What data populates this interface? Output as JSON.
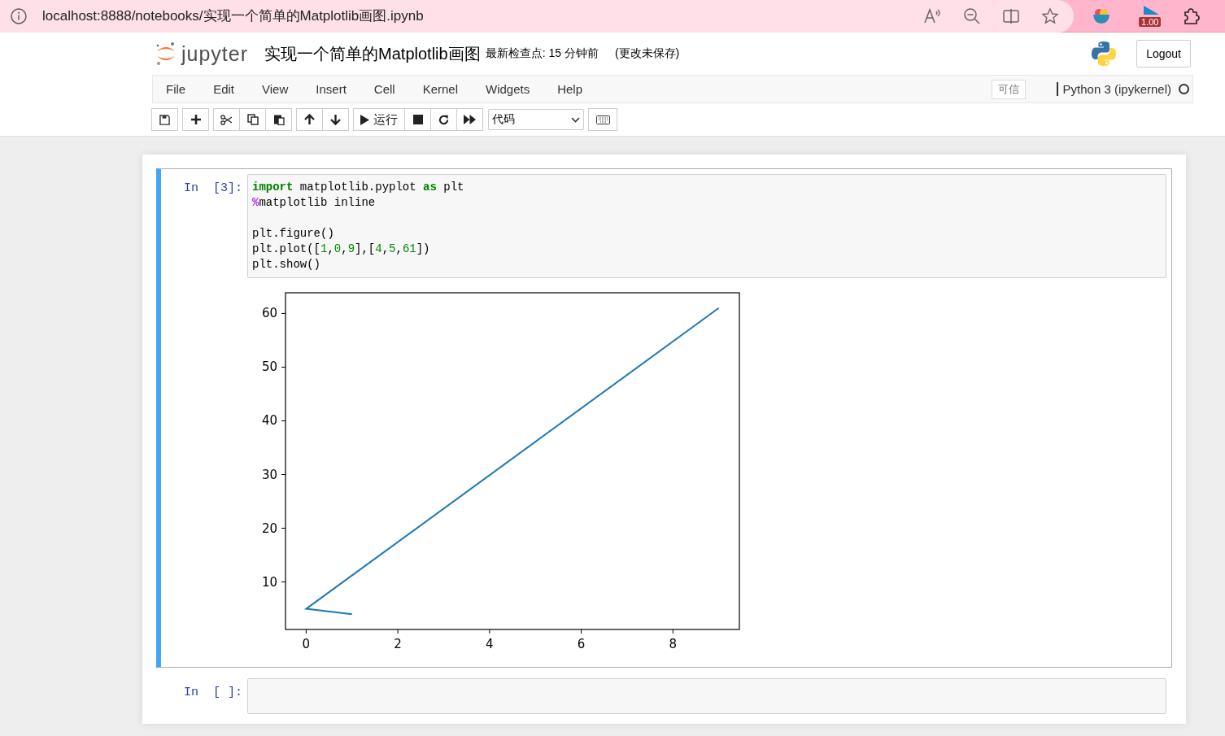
{
  "browser": {
    "url": "localhost:8888/notebooks/实现一个简单的Matplotlib画图.ipynb",
    "extension_badge": "1.00"
  },
  "header": {
    "logo_text": "jupyter",
    "title": "实现一个简单的Matplotlib画图",
    "checkpoint": "最新检查点: 15 分钟前",
    "save_status": "(更改未保存)",
    "logout": "Logout"
  },
  "menu": [
    "File",
    "Edit",
    "View",
    "Insert",
    "Cell",
    "Kernel",
    "Widgets",
    "Help"
  ],
  "trusted": "可信",
  "kernel": {
    "name": "Python 3 (ipykernel)",
    "busy": false
  },
  "toolbar": {
    "run_label": "运行",
    "cell_type": "代码"
  },
  "cells": [
    {
      "prompt": "In  [3]:",
      "selected": true,
      "lines": [
        {
          "tokens": [
            {
              "kind": "keyword",
              "text": "import"
            },
            {
              "kind": "plain",
              "text": " matplotlib.pyplot "
            },
            {
              "kind": "keyword",
              "text": "as"
            },
            {
              "kind": "plain",
              "text": " plt"
            }
          ]
        },
        {
          "tokens": [
            {
              "kind": "magic",
              "text": "%"
            },
            {
              "kind": "plain",
              "text": "matplotlib inline"
            }
          ]
        },
        {
          "blank_before": true,
          "tokens": [
            {
              "kind": "plain",
              "text": "plt.figure()"
            }
          ]
        },
        {
          "tokens": [
            {
              "kind": "plain",
              "text": "plt.plot(["
            },
            {
              "kind": "number",
              "text": "1"
            },
            {
              "kind": "plain",
              "text": ","
            },
            {
              "kind": "number",
              "text": "0"
            },
            {
              "kind": "plain",
              "text": ","
            },
            {
              "kind": "number",
              "text": "9"
            },
            {
              "kind": "plain",
              "text": "],["
            },
            {
              "kind": "number",
              "text": "4"
            },
            {
              "kind": "plain",
              "text": ","
            },
            {
              "kind": "number",
              "text": "5"
            },
            {
              "kind": "plain",
              "text": ","
            },
            {
              "kind": "number",
              "text": "61"
            },
            {
              "kind": "plain",
              "text": "])"
            }
          ]
        },
        {
          "tokens": [
            {
              "kind": "plain",
              "text": "plt.show()"
            }
          ]
        }
      ],
      "output": {
        "chart_data": {
          "type": "line",
          "x": [
            1,
            0,
            9
          ],
          "series": [
            {
              "color": "#1f77b4",
              "values": [
                4,
                5,
                61
              ]
            }
          ],
          "xlim": [
            -0.45,
            9.45
          ],
          "ylim": [
            1.15,
            63.85
          ],
          "xticks": [
            0,
            2,
            4,
            6,
            8
          ],
          "yticks": [
            10,
            20,
            30,
            40,
            50,
            60
          ]
        }
      }
    },
    {
      "prompt": "In  [ ]:",
      "selected": false
    }
  ]
}
